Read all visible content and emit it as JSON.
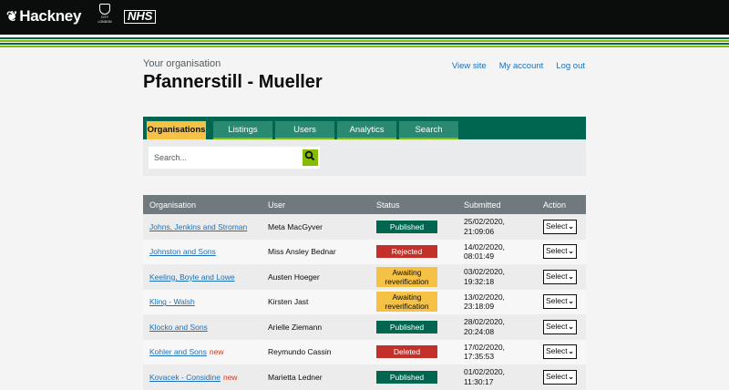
{
  "header": {
    "brand": "Hackney",
    "crest_text": [
      "CITY",
      "LONDON"
    ],
    "nhs": "NHS"
  },
  "org_caption": "Your organisation",
  "org_name": "Pfannerstill - Mueller",
  "links": {
    "view_site": "View site",
    "my_account": "My account",
    "log_out": "Log out"
  },
  "tabs": [
    {
      "label": "Organisations",
      "active": true
    },
    {
      "label": "Listings",
      "active": false
    },
    {
      "label": "Users",
      "active": false
    },
    {
      "label": "Analytics",
      "active": false
    },
    {
      "label": "Search",
      "active": false
    }
  ],
  "search": {
    "placeholder": "Search..."
  },
  "table": {
    "headers": [
      "Organisation",
      "User",
      "Status",
      "Submitted",
      "Action"
    ],
    "rows": [
      {
        "org": "Johns, Jenkins and Stroman",
        "new": "",
        "user": "Meta MacGyver",
        "status": "Published",
        "status_type": "published",
        "date": "25/02/2020,",
        "time": "21:09:06",
        "action": "Select"
      },
      {
        "org": "Johnston and Sons",
        "new": "",
        "user": "Miss Ansley Bednar",
        "status": "Rejected",
        "status_type": "rejected",
        "date": "14/02/2020,",
        "time": "08:01:49",
        "action": "Select"
      },
      {
        "org": "Keeling, Boyle and Lowe",
        "new": "",
        "user": "Austen Hoeger",
        "status": "Awaiting reverification",
        "status_type": "awaiting",
        "date": "03/02/2020,",
        "time": "19:32:18",
        "action": "Select"
      },
      {
        "org": "Kling - Walsh",
        "new": "",
        "user": "Kirsten Jast",
        "status": "Awaiting reverification",
        "status_type": "awaiting",
        "date": "13/02/2020,",
        "time": "23:18:09",
        "action": "Select"
      },
      {
        "org": "Klocko and Sons",
        "new": "",
        "user": "Arielle Ziemann",
        "status": "Published",
        "status_type": "published",
        "date": "28/02/2020,",
        "time": "20:24:08",
        "action": "Select"
      },
      {
        "org": "Kohler and Sons",
        "new": "new",
        "user": "Reymundo Cassin",
        "status": "Deleted",
        "status_type": "deleted",
        "date": "17/02/2020,",
        "time": "17:35:53",
        "action": "Select"
      },
      {
        "org": "Kovacek - Considine",
        "new": "new",
        "user": "Marietta Ledner",
        "status": "Published",
        "status_type": "published",
        "date": "01/02/2020,",
        "time": "11:30:17",
        "action": "Select"
      }
    ]
  },
  "colors": {
    "header_bg": "#0b0c0c",
    "brand_green": "#00664f",
    "lime": "#84bd00",
    "active_tab": "#f6c245",
    "danger": "#c3302a",
    "link": "#1d70b8"
  }
}
